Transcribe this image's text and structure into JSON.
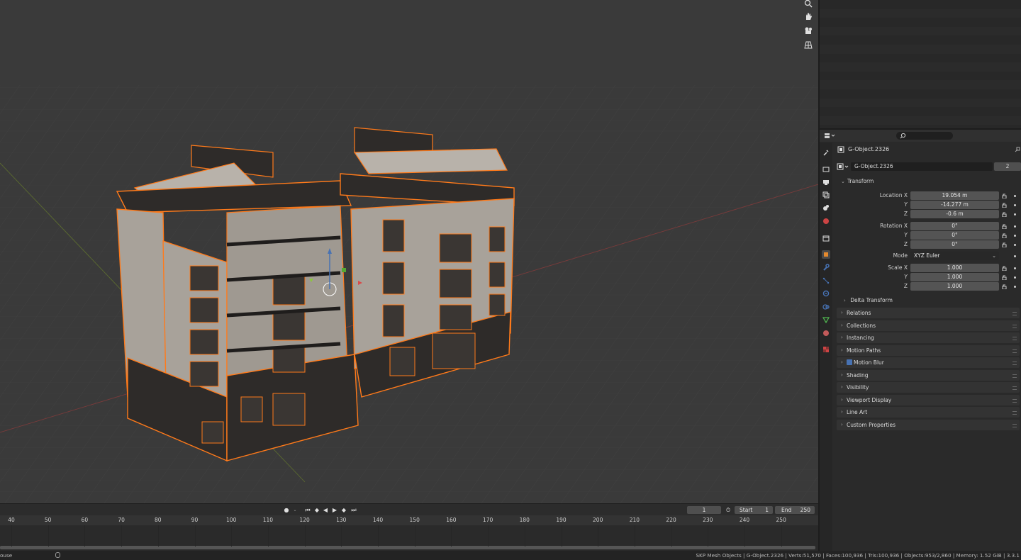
{
  "properties": {
    "header_search_icon": "search-icon",
    "object_name": "G-Object.2326",
    "data_name": "G-Object.2326",
    "users_count": "2",
    "transform_panel": {
      "title": "Transform",
      "location_x_label": "Location X",
      "location_y_label": "Y",
      "location_z_label": "Z",
      "location_x": "19.054 m",
      "location_y": "-14.277 m",
      "location_z": "-0.6 m",
      "rotation_x_label": "Rotation X",
      "rotation_y_label": "Y",
      "rotation_z_label": "Z",
      "rotation_x": "0°",
      "rotation_y": "0°",
      "rotation_z": "0°",
      "mode_label": "Mode",
      "mode_value": "XYZ Euler",
      "scale_x_label": "Scale X",
      "scale_y_label": "Y",
      "scale_z_label": "Z",
      "scale_x": "1.000",
      "scale_y": "1.000",
      "scale_z": "1.000",
      "delta_transform": "Delta Transform"
    },
    "panels": [
      "Relations",
      "Collections",
      "Instancing",
      "Motion Paths",
      "Motion Blur",
      "Shading",
      "Visibility",
      "Viewport Display",
      "Line Art",
      "Custom Properties"
    ],
    "motion_blur_checked": true
  },
  "timeline": {
    "current_frame": "1",
    "start_label": "Start",
    "start_value": "1",
    "end_label": "End",
    "end_value": "250",
    "ruler_ticks": [
      "40",
      "50",
      "60",
      "70",
      "80",
      "90",
      "100",
      "110",
      "120",
      "130",
      "140",
      "150",
      "160",
      "170",
      "180",
      "190",
      "200",
      "210",
      "220",
      "230",
      "240",
      "250"
    ]
  },
  "statusbar": {
    "left_text": "ouse",
    "right_text": "SKP Mesh Objects | G-Object.2326 | Verts:51,570 | Faces:100,936 | Tris:100,936 | Objects:953/2,860 | Memory: 1.52 GiB | 3.3.1"
  },
  "colors": {
    "selection_outline": "#ff7a1a",
    "building_wall": "#a8a29a",
    "building_dark": "#2e2b29",
    "accent_blue": "#4772b3"
  }
}
